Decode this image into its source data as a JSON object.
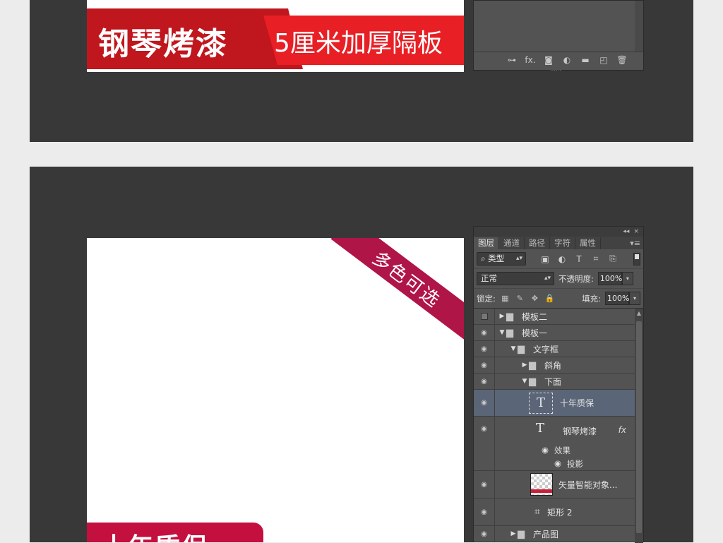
{
  "top_banner": {
    "title": "钢琴烤漆",
    "subtitle": "5厘米加厚隔板"
  },
  "top_layers_bar": {
    "icons": [
      "link-icon",
      "fx-icon",
      "mask-icon",
      "adjustment-icon",
      "folder-icon",
      "new-layer-icon",
      "trash-icon"
    ],
    "fx_label": "fx."
  },
  "bottom_canvas": {
    "corner_ribbon": "多色可选",
    "bottom_ribbon": "十年质保"
  },
  "layers_panel": {
    "collapse": "◂◂",
    "close": "×",
    "tabs": [
      {
        "label": "图层"
      },
      {
        "label": "通道"
      },
      {
        "label": "路径"
      },
      {
        "label": "字符"
      },
      {
        "label": "属性"
      }
    ],
    "filter_label": "类型",
    "filter_search_icon": "⌕",
    "blend_mode": "正常",
    "opacity_label": "不透明度:",
    "opacity_value": "100%",
    "lock_label": "锁定:",
    "fill_label": "填充:",
    "fill_value": "100%",
    "layers": [
      {
        "name": "模板二",
        "visible": false,
        "expanded": false,
        "kind": "folder",
        "level": 0
      },
      {
        "name": "模板一",
        "visible": true,
        "expanded": true,
        "kind": "folder",
        "level": 0
      },
      {
        "name": "文字框",
        "visible": true,
        "expanded": true,
        "kind": "folder",
        "level": 1
      },
      {
        "name": "斜角",
        "visible": true,
        "expanded": false,
        "kind": "folder",
        "level": 2
      },
      {
        "name": "下面",
        "visible": true,
        "expanded": true,
        "kind": "folder",
        "level": 2
      },
      {
        "name": "十年质保",
        "visible": true,
        "kind": "text",
        "selected": true
      },
      {
        "name": "钢琴烤漆",
        "visible": true,
        "kind": "text",
        "has_fx": true,
        "fx": "fx",
        "effects_label": "效果",
        "effect": "投影"
      },
      {
        "name": "矢量智能对象...",
        "visible": true,
        "kind": "smart"
      },
      {
        "name": "矩形 2",
        "visible": true,
        "kind": "shape"
      },
      {
        "name": "产品图",
        "visible": true,
        "expanded": false,
        "kind": "folder",
        "level": 1
      }
    ]
  }
}
